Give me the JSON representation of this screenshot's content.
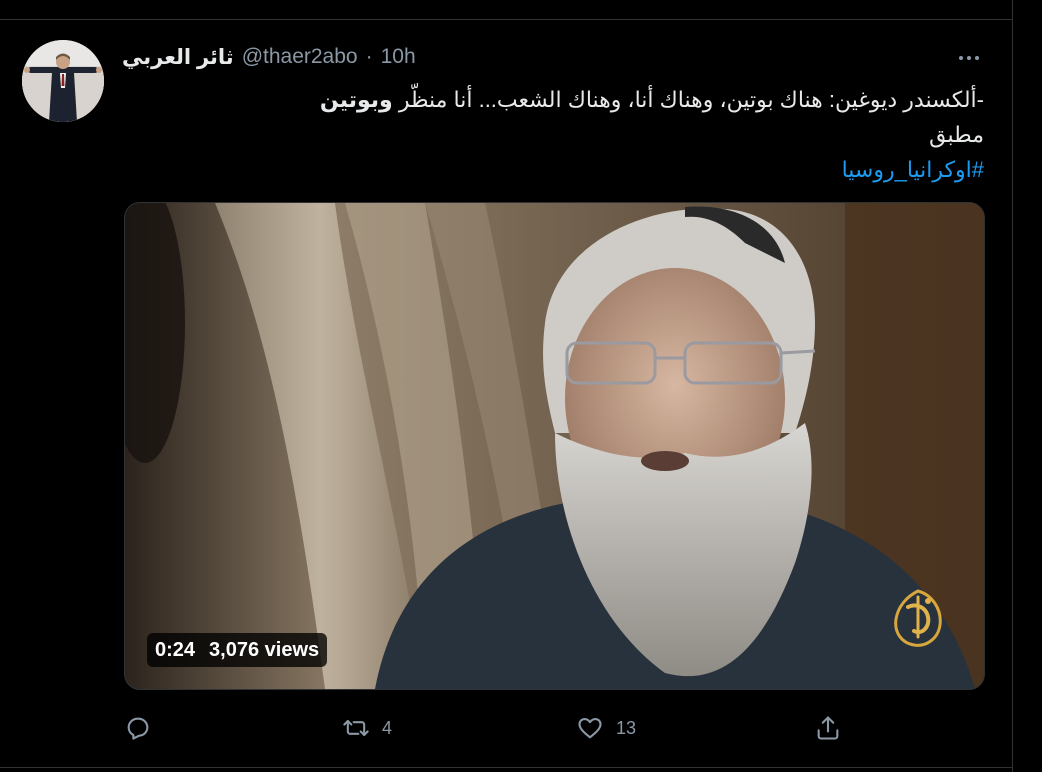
{
  "tweet": {
    "display_name": "ثائر العربي",
    "handle": "@thaer2abo",
    "separator": "·",
    "time": "10h",
    "text": {
      "line1_before_bold": "-ألكسندر ديوغين:  هناك بوتين، وهناك أنا، وهناك الشعب... أنا منظّر ",
      "line1_bold": "وبوتين",
      "line2": "مطبق",
      "hashtag": "#اوكرانيا_روسيا"
    }
  },
  "video": {
    "duration": "0:24",
    "views": "3,076 views"
  },
  "actions": {
    "reply_count": "",
    "retweet_count": "4",
    "like_count": "13"
  },
  "icons": {
    "more": "more-horizontal-icon",
    "reply": "reply-icon",
    "retweet": "retweet-icon",
    "like": "heart-icon",
    "share": "share-icon"
  },
  "colors": {
    "background": "#000000",
    "text_primary": "#e7e9ea",
    "text_secondary": "#8b98a5",
    "link": "#1d9bf0",
    "border": "#2f3336"
  }
}
